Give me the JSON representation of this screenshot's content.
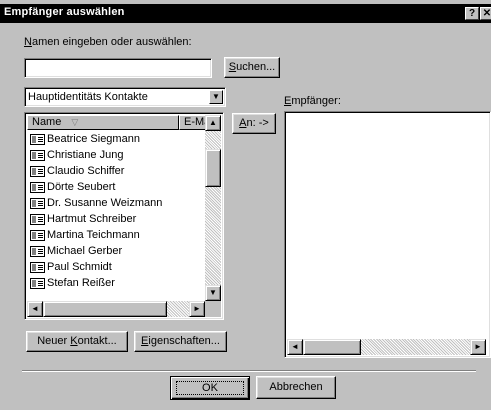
{
  "window": {
    "title": "Empfänger auswählen",
    "help_label": "?",
    "close_label": "✕"
  },
  "search": {
    "prompt_label": "Namen eingeben oder auswählen:",
    "prompt_accel": "N",
    "prompt_rest": "amen eingeben oder auswählen:",
    "value": "",
    "button_accel": "S",
    "button_rest": "uchen..."
  },
  "addressbook": {
    "selected": "Hauptidentitäts Kontakte",
    "dropdown_arrow": "▼"
  },
  "contact_list": {
    "columns": [
      {
        "label": "Name",
        "sort_icon": "▽"
      },
      {
        "label": "E-Ma"
      }
    ],
    "items": [
      "Beatrice Siegmann",
      "Christiane Jung",
      "Claudio Schiffer",
      "Dörte Seubert",
      "Dr. Susanne Weizmann",
      "Hartmut Schreiber",
      "Martina Teichmann",
      "Michael Gerber",
      "Paul Schmidt",
      "Stefan Reißer"
    ],
    "vscroll": {
      "up": "▲",
      "down": "▼"
    },
    "hscroll": {
      "left": "◄",
      "right": "►"
    }
  },
  "to_button": {
    "accel": "A",
    "rest": "n: ->"
  },
  "recipients": {
    "label_accel": "E",
    "label_rest": "mpfänger:",
    "hscroll": {
      "left": "◄",
      "right": "►"
    }
  },
  "actions": {
    "new_contact_pre": "Neuer ",
    "new_contact_accel": "K",
    "new_contact_rest": "ontakt...",
    "properties_accel": "E",
    "properties_rest": "igenschaften..."
  },
  "footer": {
    "ok_label": "OK",
    "cancel_label": "Abbrechen"
  }
}
